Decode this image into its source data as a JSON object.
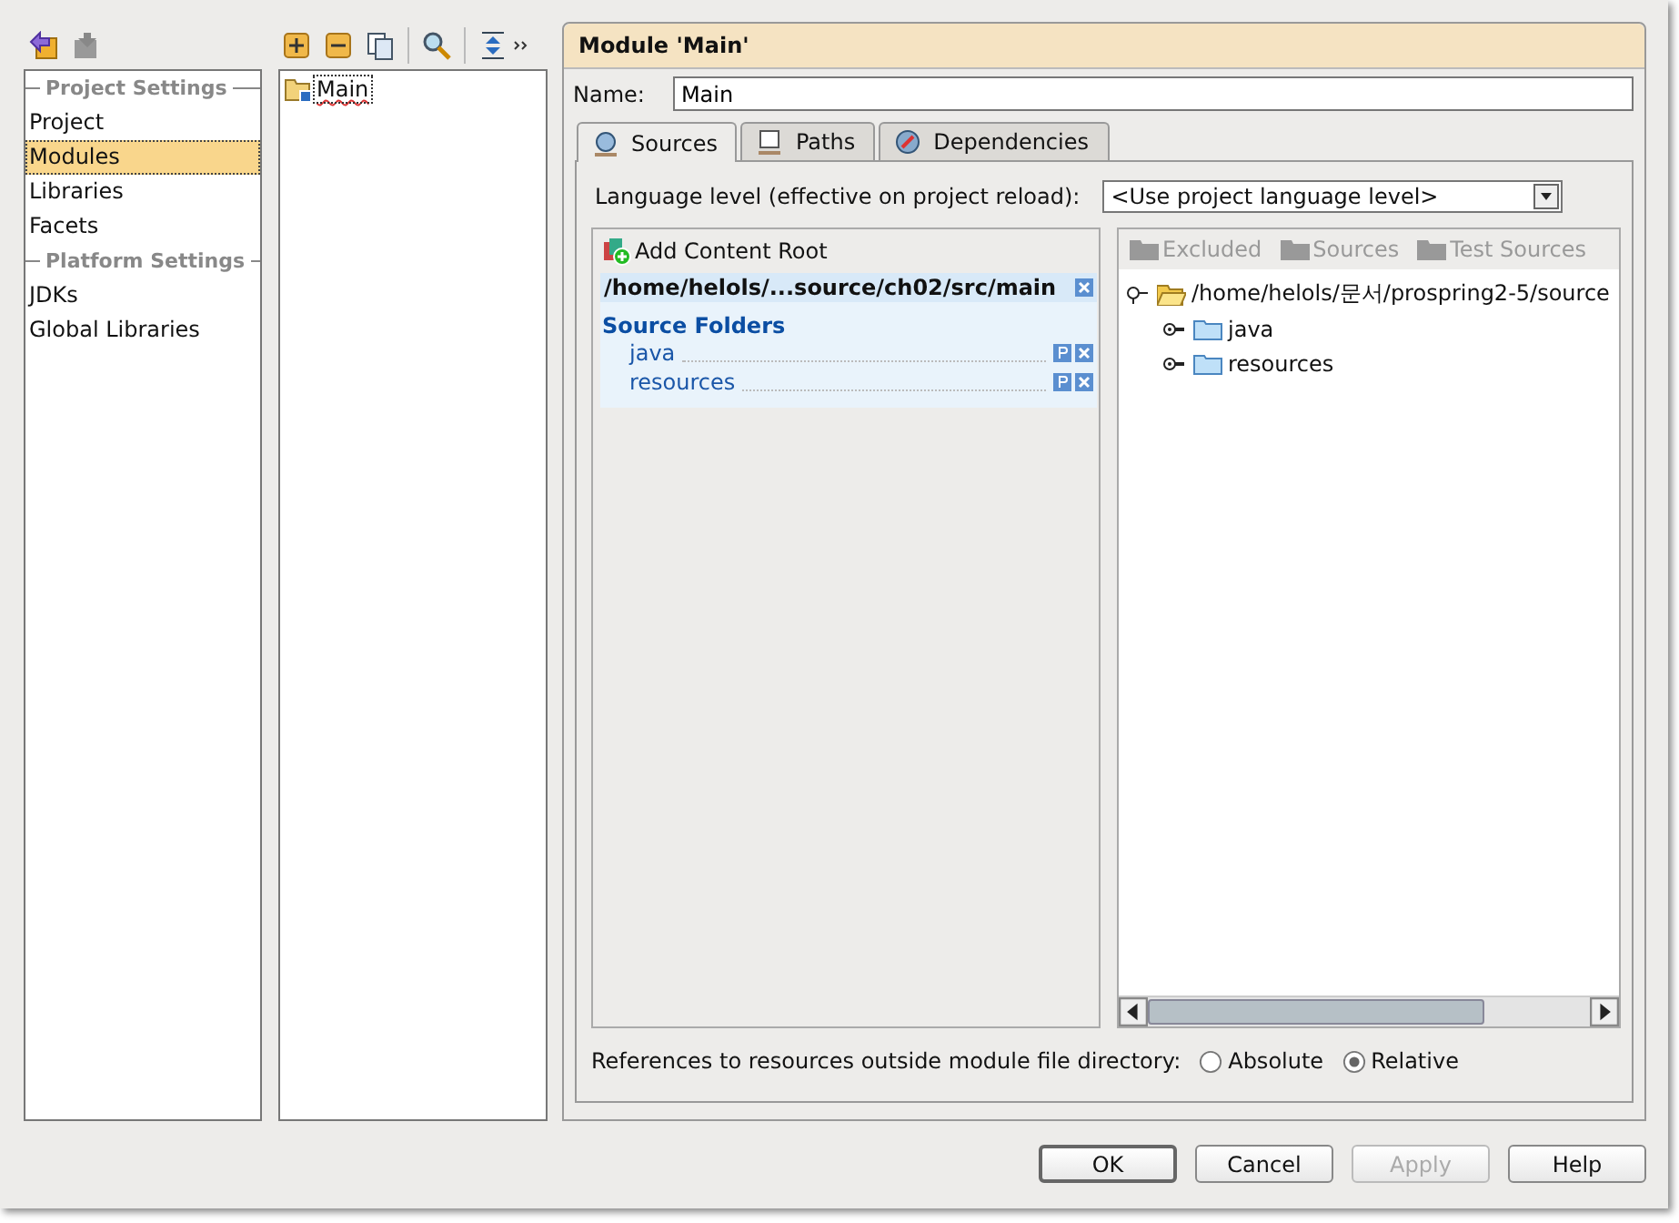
{
  "categories": [
    {
      "kind": "header",
      "label": "Project Settings"
    },
    {
      "kind": "item",
      "label": "Project",
      "selected": false
    },
    {
      "kind": "item",
      "label": "Modules",
      "selected": true
    },
    {
      "kind": "item",
      "label": "Libraries",
      "selected": false
    },
    {
      "kind": "item",
      "label": "Facets",
      "selected": false
    },
    {
      "kind": "header",
      "label": "Platform Settings"
    },
    {
      "kind": "item",
      "label": "JDKs",
      "selected": false
    },
    {
      "kind": "item",
      "label": "Global Libraries",
      "selected": false
    }
  ],
  "modules": [
    {
      "label": "Main",
      "selected": true
    }
  ],
  "module": {
    "title": "Module 'Main'",
    "name_label": "Name:",
    "name_value": "Main",
    "tabs": [
      {
        "label": "Sources",
        "selected": true
      },
      {
        "label": "Paths",
        "selected": false
      },
      {
        "label": "Dependencies",
        "selected": false
      }
    ],
    "language_label": "Language level (effective on project reload):",
    "language_value": "<Use project language level>",
    "add_root": "Add Content Root",
    "root_path": "/home/helols/...source/ch02/src/main",
    "section_title": "Source Folders",
    "folders": [
      "java",
      "resources"
    ],
    "mark_buttons": [
      {
        "label": "Excluded",
        "disabled": true
      },
      {
        "label": "Sources",
        "disabled": true
      },
      {
        "label": "Test Sources",
        "disabled": true
      }
    ],
    "tree": {
      "label": "/home/helols/문서/prospring2-5/source",
      "expanded": true,
      "children": [
        {
          "label": "java",
          "expanded": false
        },
        {
          "label": "resources",
          "expanded": false
        }
      ]
    },
    "references_label": "References to resources outside module file directory:",
    "radios": [
      {
        "label": "Absolute",
        "selected": false
      },
      {
        "label": "Relative",
        "selected": true
      }
    ]
  },
  "buttons": [
    {
      "label": "OK",
      "disabled": false
    },
    {
      "label": "Cancel",
      "disabled": false
    },
    {
      "label": "Apply",
      "disabled": true
    },
    {
      "label": "Help",
      "disabled": false
    }
  ]
}
